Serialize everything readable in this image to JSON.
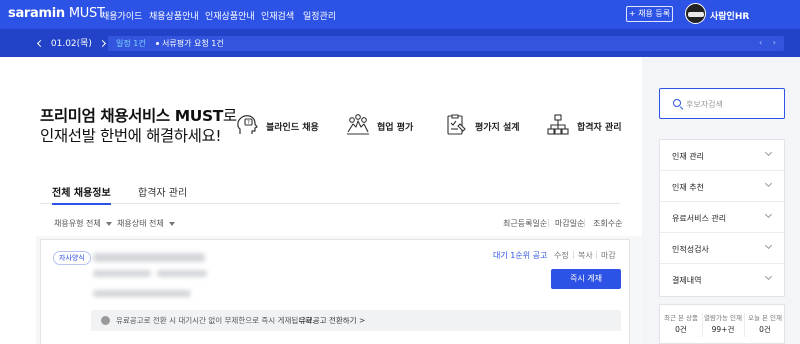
{
  "topnav": {
    "logo_brand": "saramin",
    "logo_product": "MUST",
    "links": [
      "채용가이드",
      "채용상품안내",
      "인재상품안내",
      "인재검색",
      "일정관리"
    ],
    "post_button": "+ 채용 등록",
    "company_name": "사람인HR"
  },
  "subbar": {
    "date": "01.02(목)",
    "ticker_status": "일정 1건",
    "ticker_item": "서류평가 요청 1건"
  },
  "hero": {
    "headline_line1_bold": "프리미엄 채용서비스 MUST",
    "headline_line1_rest": "로",
    "headline_line2": "인재선발 한번에 해결하세요!"
  },
  "features": [
    {
      "label": "블라인드 채용",
      "icon": "blind-hiring-icon"
    },
    {
      "label": "협업 평가",
      "icon": "collaboration-icon"
    },
    {
      "label": "평가지 설계",
      "icon": "evaluation-form-icon"
    },
    {
      "label": "합격자 관리",
      "icon": "org-chart-icon"
    }
  ],
  "tabs": [
    "전체 채용정보",
    "합격자 관리"
  ],
  "filters": [
    "채용유형 전체",
    "채용상태 전체"
  ],
  "sorts": [
    "최근등록일순",
    "마감일순",
    "조회수순"
  ],
  "card": {
    "badge": "자사양식",
    "status_link": "대기 1순위 공고",
    "actions": [
      "수정",
      "복사",
      "마감"
    ],
    "post_now": "즉시 게재",
    "notice_text": "유료공고로 전환 시 대기시간 없이 무제한으로 즉시 게재됩니다.",
    "notice_link": "유료공고 전환하기 >"
  },
  "sidebar": {
    "search_placeholder": "후보자검색",
    "menu": [
      "인재 관리",
      "인재 추천",
      "유료서비스 관리",
      "인적성검사",
      "결제내역"
    ],
    "stats": [
      {
        "label": "최근 본 상품",
        "value": "0건"
      },
      {
        "label": "열람가능 인재",
        "value": "99+건"
      },
      {
        "label": "오늘 본 인재",
        "value": "0건"
      }
    ]
  },
  "colors": {
    "brand_blue": "#2d52e6",
    "subbar_blue": "#2242c8",
    "ticker_status": "#7fd3ff"
  }
}
